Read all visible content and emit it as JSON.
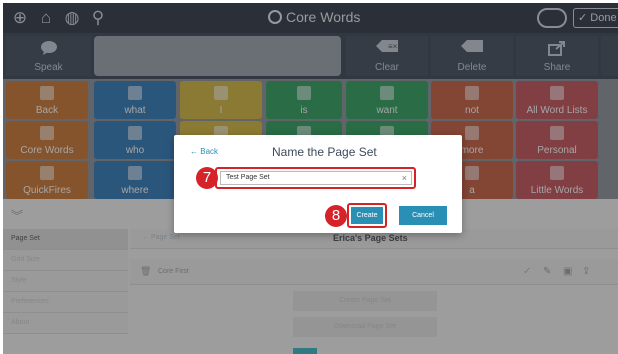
{
  "app": {
    "title": "Core Words",
    "done_label": "Done"
  },
  "toolbar": {
    "speak_label": "Speak",
    "clear_label": "Clear",
    "delete_label": "Delete",
    "share_label": "Share"
  },
  "grid": {
    "rows": [
      [
        {
          "label": "Back",
          "color": "#c9742f",
          "icon": "back-arrow-icon"
        },
        {
          "label": "what",
          "color": "#2e78b7",
          "icon": "question-icon"
        },
        {
          "label": "I",
          "color": "#d3b63c",
          "icon": "person-icon"
        },
        {
          "label": "is",
          "color": "#2a9d5b",
          "icon": "equals-icon"
        },
        {
          "label": "want",
          "color": "#2a9d5b",
          "icon": "want-icon"
        },
        {
          "label": "not",
          "color": "#c55a3d",
          "icon": "no-icon"
        },
        {
          "label": "All Word Lists",
          "color": "#c24e57",
          "icon": "list-icon"
        }
      ],
      [
        {
          "label": "Core Words",
          "color": "#c9742f",
          "icon": "target-icon"
        },
        {
          "label": "who",
          "color": "#2e78b7",
          "icon": "question-icon"
        },
        {
          "label": "",
          "color": "#d3b63c",
          "icon": "person-icon"
        },
        {
          "label": "",
          "color": "#2a9d5b",
          "icon": "action-icon"
        },
        {
          "label": "",
          "color": "#2a9d5b",
          "icon": "face-icon"
        },
        {
          "label": "more",
          "color": "#c55a3d",
          "icon": "more-icon"
        },
        {
          "label": "Personal",
          "color": "#c24e57",
          "icon": "personal-icon"
        }
      ],
      [
        {
          "label": "QuickFires",
          "color": "#c9742f",
          "icon": "fire-icon"
        },
        {
          "label": "where",
          "color": "#2e78b7",
          "icon": "where-icon"
        },
        {
          "label": "",
          "color": "#d3b63c",
          "icon": "blank-icon"
        },
        {
          "label": "",
          "color": "#2a9d5b",
          "icon": "blank-icon"
        },
        {
          "label": "",
          "color": "#2a9d5b",
          "icon": "blank-icon"
        },
        {
          "label": "a",
          "color": "#c55a3d",
          "icon": "letter-a-icon"
        },
        {
          "label": "Little Words",
          "color": "#c24e57",
          "icon": "little-words-icon"
        }
      ]
    ]
  },
  "settings": {
    "nav": [
      "Page Set",
      "Grid Size",
      "Style",
      "Preferences",
      "About"
    ],
    "page_sets_back": "Page Set",
    "page_sets_title": "Erica's Page Sets",
    "row_name": "Core First",
    "create_page_set": "Create Page Set",
    "download_page_set": "Download Page Set"
  },
  "dialog": {
    "back_label": "Back",
    "title": "Name the Page Set",
    "input_value": "Test Page Set",
    "clear_symbol": "×",
    "create_label": "Create",
    "cancel_label": "Cancel",
    "step_input": "7",
    "step_create": "8"
  },
  "colors": {
    "accent": "#2a8fb5",
    "highlight": "#d6232a"
  }
}
